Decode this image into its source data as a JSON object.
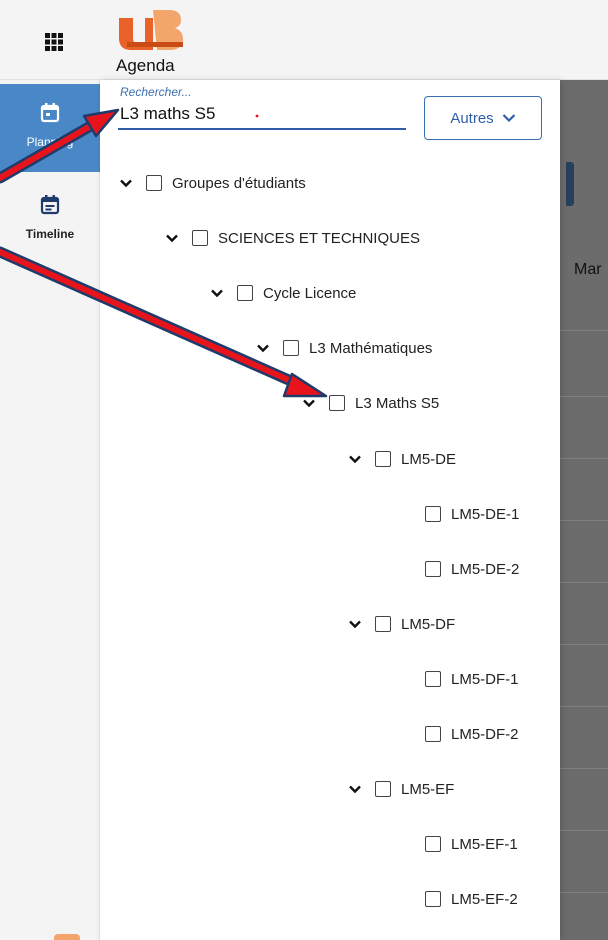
{
  "app": {
    "name": "Agenda",
    "logo_icon": "ub-logo-icon",
    "apps_icon": "apps-grid-icon"
  },
  "rail": {
    "items": [
      {
        "label": "Planning",
        "icon": "calendar-icon",
        "active": true
      },
      {
        "label": "Timeline",
        "icon": "timeline-icon",
        "active": false
      }
    ]
  },
  "search": {
    "label": "Rechercher...",
    "value": "L3 maths S5",
    "button_label": "Autres",
    "button_icon": "chevron-down-icon"
  },
  "tree": [
    {
      "label": "Groupes d'étudiants",
      "expandable": true
    },
    {
      "label": "SCIENCES ET TECHNIQUES",
      "expandable": true
    },
    {
      "label": "Cycle Licence",
      "expandable": true
    },
    {
      "label": "L3 Mathématiques",
      "expandable": true
    },
    {
      "label": "L3 Maths S5",
      "expandable": true
    },
    {
      "label": "LM5-DE",
      "expandable": true
    },
    {
      "label": "LM5-DE-1",
      "expandable": false
    },
    {
      "label": "LM5-DE-2",
      "expandable": false
    },
    {
      "label": "LM5-DF",
      "expandable": true
    },
    {
      "label": "LM5-DF-1",
      "expandable": false
    },
    {
      "label": "LM5-DF-2",
      "expandable": false
    },
    {
      "label": "LM5-EF",
      "expandable": true
    },
    {
      "label": "LM5-EF-1",
      "expandable": false
    },
    {
      "label": "LM5-EF-2",
      "expandable": false
    }
  ],
  "background": {
    "column_label": "Mar"
  },
  "colors": {
    "accent": "#4a87c6",
    "link": "#2e5ea8",
    "annotation_arrow": "#e8141b",
    "overlay": "#6c6c6c"
  }
}
